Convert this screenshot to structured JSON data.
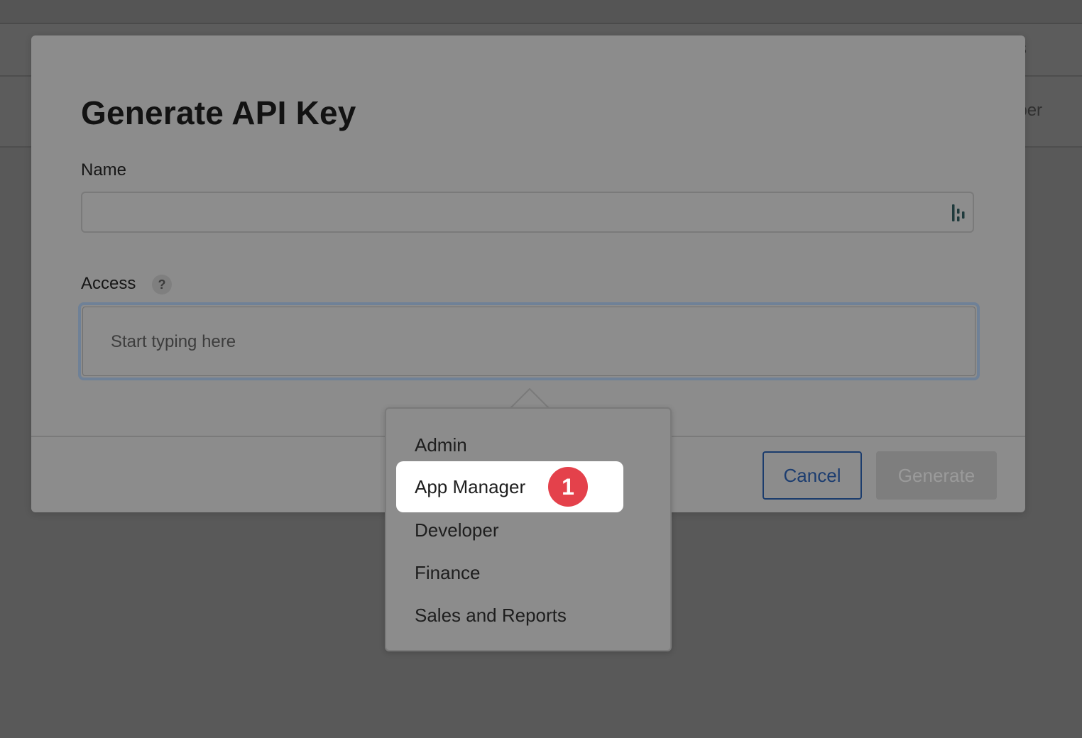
{
  "background": {
    "nav_partial_text": "ss",
    "subnav_partial_text": "oper"
  },
  "modal": {
    "title": "Generate API Key",
    "name_label": "Name",
    "name_value": "",
    "access_label": "Access",
    "access_help": "?",
    "access_placeholder": "Start typing here",
    "cancel_label": "Cancel",
    "generate_label": "Generate"
  },
  "dropdown": {
    "items": [
      {
        "label": "Admin"
      },
      {
        "label": "App Manager"
      },
      {
        "label": "Developer"
      },
      {
        "label": "Finance"
      },
      {
        "label": "Sales and Reports"
      }
    ],
    "highlighted_index": 1
  },
  "callout": {
    "step": "1"
  },
  "colors": {
    "accent_blue": "#1c3d70",
    "focus_ring": "#6f8197",
    "badge_red": "#e4414b"
  },
  "icons": {
    "password_manager": "password-manager-icon",
    "help": "question-icon"
  }
}
